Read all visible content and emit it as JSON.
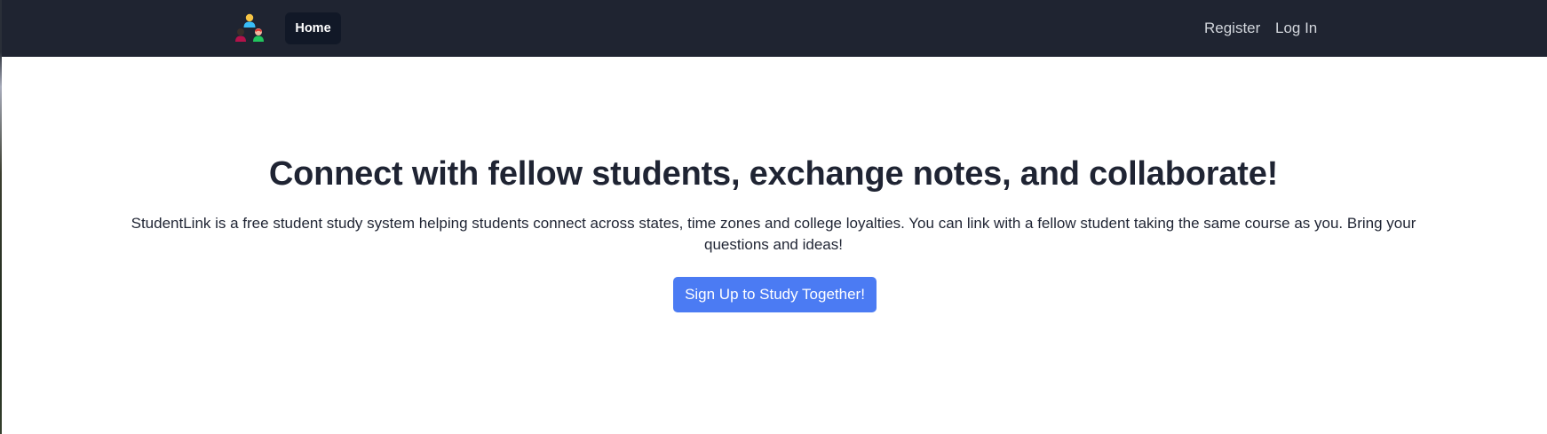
{
  "nav": {
    "home_label": "Home",
    "register_label": "Register",
    "login_label": "Log In",
    "logo_icon": "students-group-icon"
  },
  "hero": {
    "title": "Connect with fellow students, exchange notes, and collaborate!",
    "description": "StudentLink is a free student study system helping students connect across states, time zones and college loyalties. You can link with a fellow student taking the same course as you. Bring your questions and ideas!",
    "cta_label": "Sign Up to Study Together!"
  },
  "colors": {
    "navbar_bg": "#1f2431",
    "active_nav_bg": "#111827",
    "cta_bg": "#4b7bf3",
    "heading_text": "#1f2433"
  }
}
